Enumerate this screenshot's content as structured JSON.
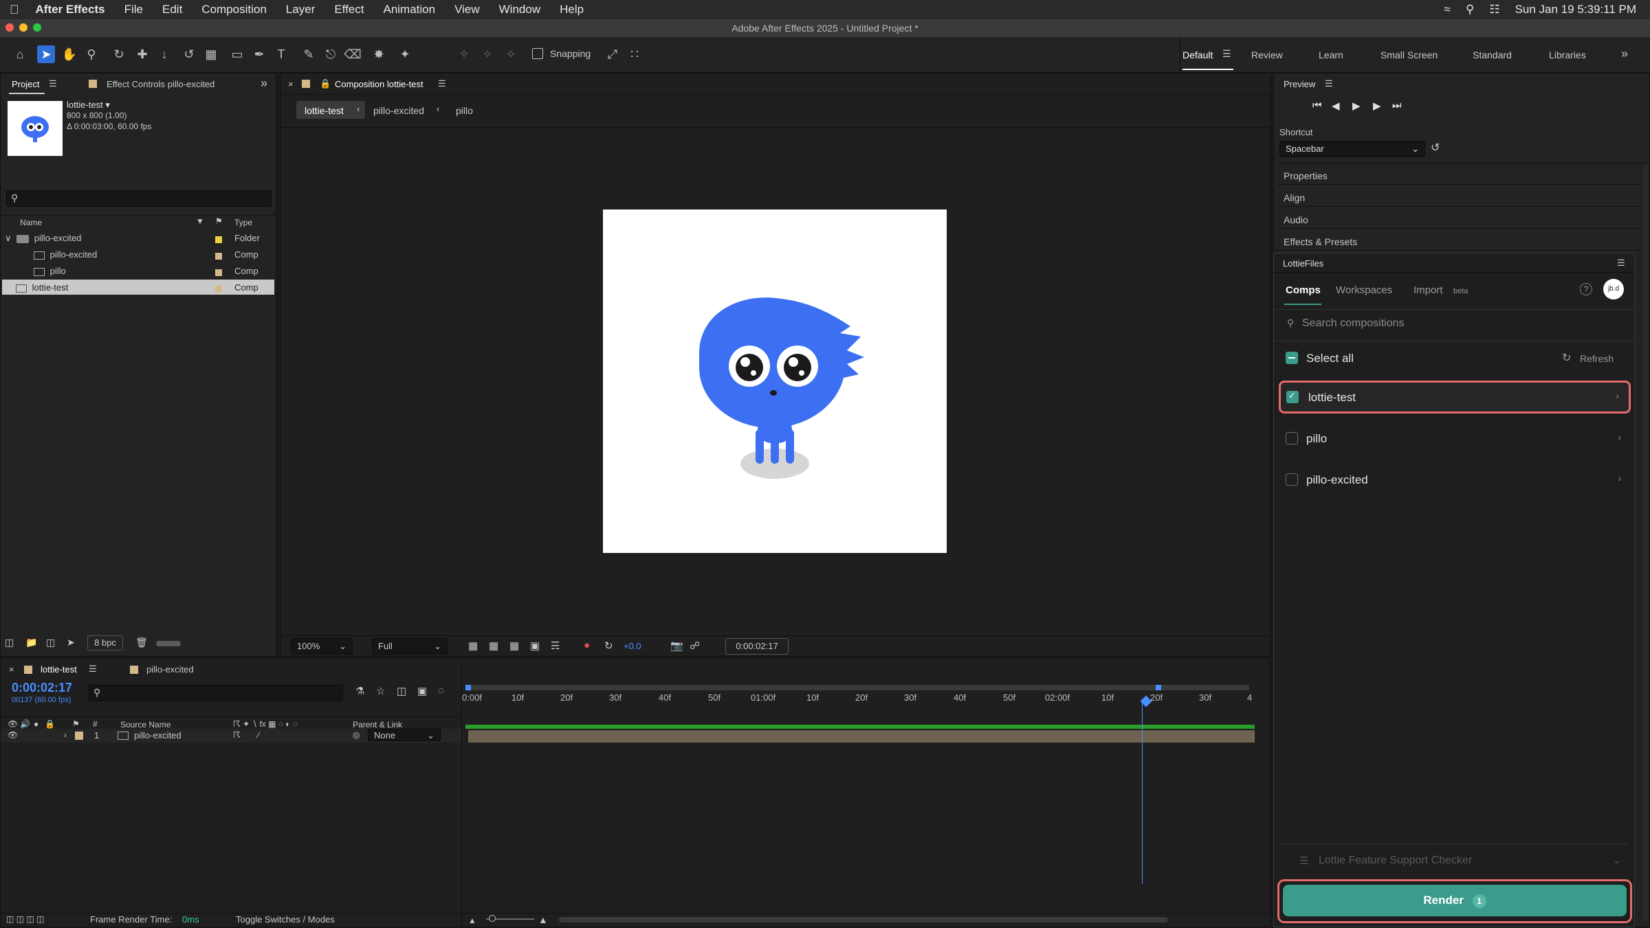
{
  "menubar": {
    "app": "After Effects",
    "items": [
      "File",
      "Edit",
      "Composition",
      "Layer",
      "Effect",
      "Animation",
      "View",
      "Window",
      "Help"
    ],
    "clock": "Sun Jan 19  5:39:11 PM"
  },
  "window_title": "Adobe After Effects 2025 - Untitled Project *",
  "toolbar": {
    "snapping": "Snapping"
  },
  "workspaces": [
    "Default",
    "Review",
    "Learn",
    "Small Screen",
    "Standard",
    "Libraries"
  ],
  "project": {
    "tab": "Project",
    "effect_tab": "Effect Controls pillo-excited",
    "thumb_name": "lottie-test ▾",
    "thumb_size": "800 x 800 (1.00)",
    "thumb_dur": "Δ 0:00:03:00, 60.00 fps",
    "col_name": "Name",
    "col_type": "Type",
    "items": [
      {
        "name": "pillo-excited",
        "type": "Folder"
      },
      {
        "name": "pillo-excited",
        "type": "Comp"
      },
      {
        "name": "pillo",
        "type": "Comp"
      },
      {
        "name": "lottie-test",
        "type": "Comp"
      }
    ],
    "bpc": "8 bpc"
  },
  "comp": {
    "tab": "Composition lottie-test",
    "crumbs": [
      "lottie-test",
      "pillo-excited",
      "pillo"
    ],
    "zoom": "100%",
    "quality": "Full",
    "exposure": "+0.0",
    "timecode": "0:00:02:17"
  },
  "preview": {
    "title": "Preview",
    "shortcut_label": "Shortcut",
    "shortcut_value": "Spacebar"
  },
  "side_panels": [
    "Properties",
    "Align",
    "Audio",
    "Effects & Presets"
  ],
  "lottie": {
    "title": "LottieFiles",
    "tabs": [
      "Comps",
      "Workspaces",
      "Import"
    ],
    "beta": "beta",
    "avatar": "jb.d",
    "search_placeholder": "Search compositions",
    "select_all": "Select all",
    "refresh": "Refresh",
    "comps": [
      {
        "name": "lottie-test",
        "checked": true
      },
      {
        "name": "pillo",
        "checked": false
      },
      {
        "name": "pillo-excited",
        "checked": false
      }
    ],
    "checker": "Lottie Feature Support Checker",
    "render": "Render",
    "render_count": "1",
    "accent": "#3b9c8c"
  },
  "timeline": {
    "tab": "lottie-test",
    "tab2": "pillo-excited",
    "time": "0:00:02:17",
    "frames": "00137 (60.00 fps)",
    "col_source": "Source Name",
    "col_parent": "Parent & Link",
    "col_hash": "#",
    "layer": {
      "num": "1",
      "name": "pillo-excited",
      "parent": "None"
    },
    "ticks": [
      "0:00f",
      "10f",
      "20f",
      "30f",
      "40f",
      "50f",
      "01:00f",
      "10f",
      "20f",
      "30f",
      "40f",
      "50f",
      "02:00f",
      "10f",
      "20f",
      "30f",
      "4"
    ],
    "status_label": "Frame Render Time:",
    "status_value": "0ms",
    "toggle": "Toggle Switches / Modes"
  }
}
